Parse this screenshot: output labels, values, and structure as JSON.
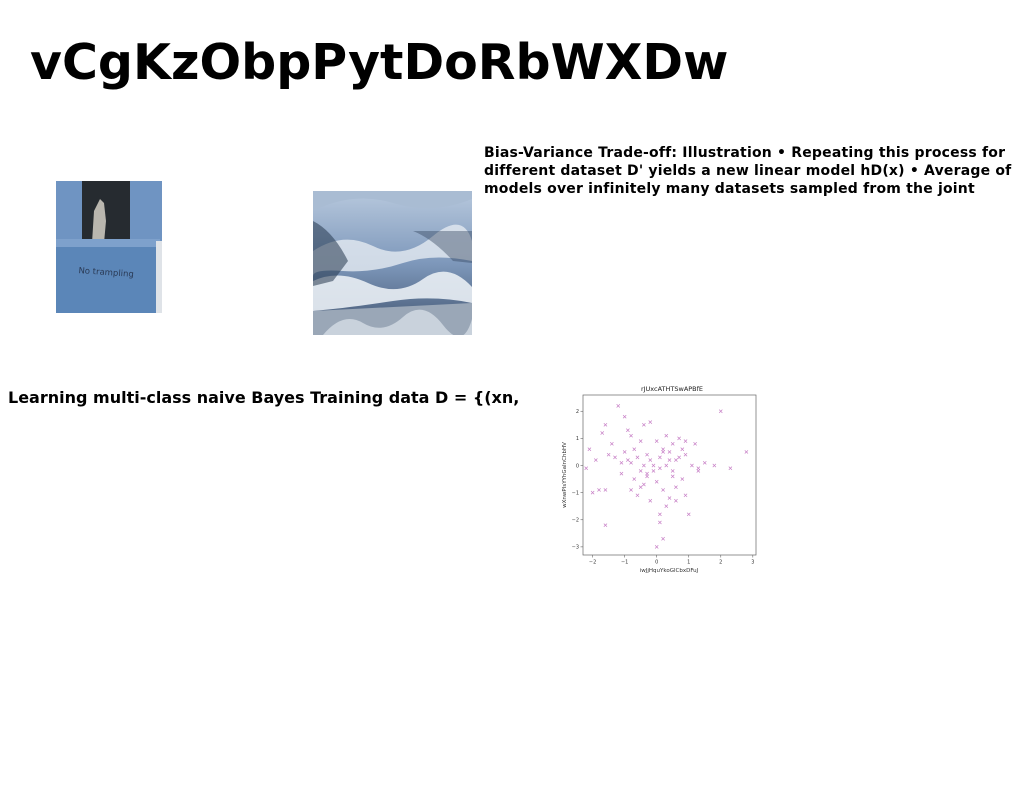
{
  "page": {
    "title": "vCgKzObpPytDoRbWXDw",
    "paragraph_right": "Bias-Variance Trade-off: Illustration • Repeating this process for different dataset D' yields a new linear model hD(x) • Average of models over infinitely many datasets sampled from the joint",
    "paragraph_left": "Learning multi-class naive Bayes Training data D = {(xn,"
  },
  "images": {
    "box_photo": {
      "sign_text": "No trampling",
      "colors": {
        "box": "#5b86b8",
        "shadow": "#2a2f33"
      }
    },
    "ice_photo": {
      "colors": {
        "ice": "#8fa6c4",
        "dark": "#1e2a3a",
        "foam": "#dde4ec"
      }
    }
  },
  "chart_data": {
    "type": "scatter",
    "title": "rJUxcATHTSwAPBfE",
    "xlabel": "iwJjHquYkoGlCbxDFuJ",
    "ylabel": "wXnwPIsYYhGaInChbHV",
    "xlim": [
      -2.3,
      3.1
    ],
    "ylim": [
      -3.3,
      2.6
    ],
    "xticks": [
      -2,
      -1,
      0,
      1,
      2,
      3
    ],
    "yticks": [
      -3,
      -2,
      -1,
      0,
      1,
      2
    ],
    "marker": "x",
    "color": "#c77fc6",
    "grid": false,
    "x": [
      -2.1,
      -2.0,
      -1.9,
      -1.8,
      -1.7,
      -1.6,
      -1.6,
      -1.5,
      -1.4,
      -1.3,
      -1.2,
      -1.1,
      -1.0,
      -1.0,
      -0.9,
      -0.9,
      -0.8,
      -0.8,
      -0.7,
      -0.7,
      -0.6,
      -0.6,
      -0.5,
      -0.5,
      -0.4,
      -0.4,
      -0.4,
      -0.3,
      -0.3,
      -0.2,
      -0.2,
      -0.2,
      -0.1,
      -0.1,
      0.0,
      0.0,
      0.0,
      0.1,
      0.1,
      0.1,
      0.2,
      0.2,
      0.2,
      0.3,
      0.3,
      0.3,
      0.4,
      0.4,
      0.5,
      0.5,
      0.5,
      0.6,
      0.6,
      0.7,
      0.7,
      0.8,
      0.8,
      0.9,
      0.9,
      1.0,
      1.1,
      1.2,
      1.3,
      1.5,
      1.8,
      2.0,
      2.3,
      2.8,
      -1.1,
      -0.5,
      0.1,
      0.4,
      0.9,
      -0.3,
      0.6,
      -1.6,
      -2.2,
      0.2,
      -0.8,
      1.3
    ],
    "y": [
      0.6,
      -1.0,
      0.2,
      -0.9,
      1.2,
      1.5,
      -2.2,
      0.4,
      0.8,
      0.3,
      2.2,
      -0.3,
      1.8,
      0.5,
      0.2,
      1.3,
      -0.9,
      0.1,
      0.6,
      -0.5,
      0.3,
      -1.1,
      0.9,
      -0.2,
      0.0,
      1.5,
      -0.7,
      0.4,
      -0.4,
      0.2,
      1.6,
      -1.3,
      0.0,
      -0.2,
      0.9,
      -0.6,
      -3.0,
      0.3,
      -1.8,
      -0.1,
      0.5,
      -0.9,
      -2.7,
      0.0,
      1.1,
      -1.5,
      0.5,
      -1.2,
      0.8,
      -0.4,
      -0.2,
      0.2,
      -0.8,
      1.0,
      0.3,
      -0.5,
      0.6,
      -1.1,
      0.4,
      -1.8,
      0.0,
      0.8,
      -0.1,
      0.1,
      0.0,
      2.0,
      -0.1,
      0.5,
      0.1,
      -0.8,
      -2.1,
      0.2,
      0.9,
      -0.3,
      -1.3,
      -0.9,
      -0.1,
      0.6,
      1.1,
      -0.2
    ]
  }
}
